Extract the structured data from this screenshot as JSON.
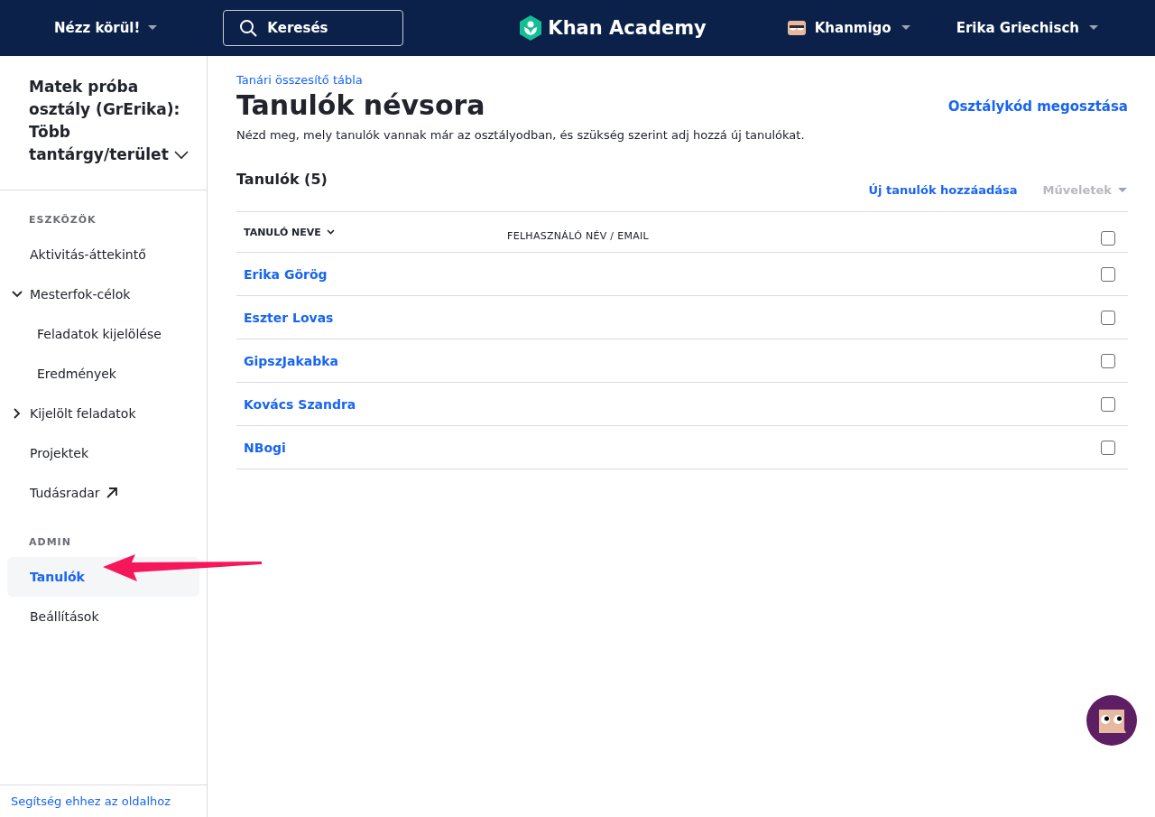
{
  "topbar": {
    "explore": "Nézz körül!",
    "search": {
      "placeholder": "Keresés"
    },
    "logo": "Khan Academy",
    "khanmigo": "Khanmigo",
    "user": "Erika Griechisch"
  },
  "sidebar": {
    "class_title": "Matek próba osztály (GrErika): Több tantárgy/terület",
    "sections": [
      {
        "heading": "ESZKÖZÖK",
        "items": [
          {
            "label": "Aktivitás-áttekintő",
            "kind": "link",
            "selected": false
          },
          {
            "label": "Mesterfok-célok",
            "kind": "group",
            "selected": false,
            "expanded": true,
            "children": [
              {
                "label": "Feladatok kijelölése",
                "kind": "link",
                "selected": false
              },
              {
                "label": "Eredmények",
                "kind": "link",
                "selected": false
              }
            ]
          },
          {
            "label": "Kijelölt feladatok",
            "kind": "group",
            "selected": false,
            "expanded": false
          },
          {
            "label": "Projektek",
            "kind": "link",
            "selected": false
          },
          {
            "label": "Tudásradar",
            "kind": "external",
            "selected": false
          }
        ]
      },
      {
        "heading": "ADMIN",
        "items": [
          {
            "label": "Tanulók",
            "kind": "link",
            "selected": true
          },
          {
            "label": "Beállítások",
            "kind": "link",
            "selected": false
          }
        ]
      }
    ],
    "help_link": "Segítség ehhez az oldalhoz"
  },
  "main": {
    "breadcrumb": "Tanári összesítő tábla",
    "title": "Tanulók névsora",
    "share_link": "Osztálykód megosztása",
    "description": "Nézd meg, mely tanulók vannak már az osztályodban, és szükség szerint adj hozzá új tanulókat.",
    "count_label": "Tanulók (5)",
    "add_link": "Új tanulók hozzáadása",
    "actions": {
      "label": "Műveletek",
      "disabled": true
    },
    "table": {
      "columns": [
        "TANULÓ NEVE",
        "FELHASZNÁLÓ NÉV / EMAIL"
      ],
      "header_checked": false,
      "rows": [
        {
          "name": "Erika Görög",
          "checked": false
        },
        {
          "name": "Eszter Lovas",
          "checked": false
        },
        {
          "name": "GipszJakabka",
          "checked": false
        },
        {
          "name": "Kovács Szandra",
          "checked": false
        },
        {
          "name": "NBogi",
          "checked": false
        }
      ]
    }
  }
}
